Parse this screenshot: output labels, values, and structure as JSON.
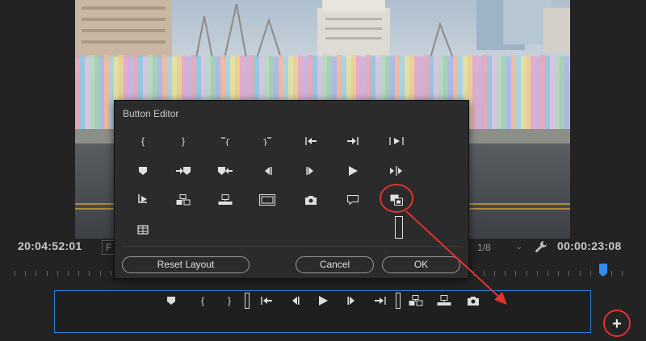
{
  "monitor": {
    "timecode_left": "20:04:52:01",
    "timecode_right": "00:00:23:08",
    "fit_stub": "F",
    "resolution": "1/8"
  },
  "dialog": {
    "title": "Button Editor",
    "reset_label": "Reset Layout",
    "cancel_label": "Cancel",
    "ok_label": "OK",
    "icons": [
      "mark-in-icon",
      "mark-out-icon",
      "clear-in-icon",
      "clear-out-icon",
      "go-to-in-icon",
      "go-to-out-icon",
      "play-in-to-out-icon",
      "add-marker-icon",
      "go-to-next-marker-icon",
      "go-to-previous-marker-icon",
      "step-back-icon",
      "step-forward-icon",
      "play-stop-icon",
      "play-around-icon",
      "loop-playback-icon",
      "insert-icon",
      "overwrite-icon",
      "safe-margins-icon",
      "export-frame-icon",
      "comparison-view-icon",
      "toggle-proxies-icon",
      "multi-camera-icon",
      "spacer-icon"
    ]
  },
  "button_bar": {
    "icons": [
      "add-marker-icon",
      "mark-in-icon",
      "mark-out-icon",
      "spacer-icon",
      "go-to-in-icon",
      "step-back-icon",
      "play-stop-icon",
      "step-forward-icon",
      "go-to-out-icon",
      "spacer-icon",
      "insert-icon",
      "overwrite-icon",
      "export-frame-icon"
    ],
    "add_label": "+"
  },
  "colors": {
    "accent_blue": "#2d7ed6",
    "annotation_red": "#e0322f",
    "playhead_blue": "#2f8cf0"
  }
}
